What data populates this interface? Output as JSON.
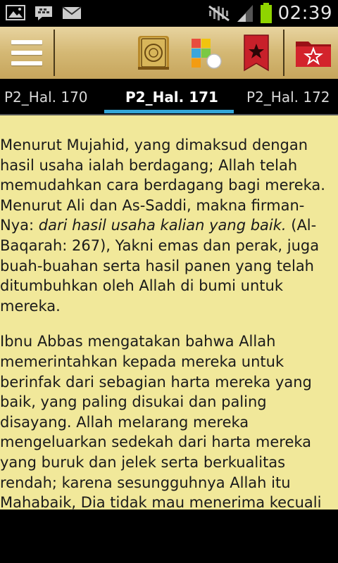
{
  "status_bar": {
    "time": "02:39",
    "icons": [
      "gallery-notification-icon",
      "bbm-notification-icon",
      "email-notification-icon",
      "mute-icon",
      "signal-icon",
      "battery-icon"
    ]
  },
  "action_bar": {
    "buttons": [
      "menu-icon",
      "quran-book-icon",
      "puzzle-icon",
      "bookmark-icon",
      "favorites-folder-icon"
    ],
    "colors": {
      "gradient_top": "#e8d4a0",
      "gradient_bottom": "#c6a55c"
    }
  },
  "tabs": [
    {
      "label": "P2_Hal. 170",
      "active": false
    },
    {
      "label": "P2_Hal. 171",
      "active": true
    },
    {
      "label": "P2_Hal. 172",
      "active": false
    }
  ],
  "content": {
    "p1_before_italic": "Menurut Mujahid, yang dimaksud dengan hasil usaha ialah berdagang; Allah telah memudahkan cara berdagang bagi mereka. Menurut Ali dan As-Saddi, makna firman-Nya: ",
    "p1_italic": "dari hasil usaha kalian yang baik.",
    "p1_after_italic": " (Al-Baqarah: 267), Yakni emas dan perak, juga buah-buahan serta hasil panen yang telah ditumbuhkan oleh Allah di bumi untuk mereka.",
    "p2": "Ibnu Abbas mengatakan bahwa Allah memerintahkan kepada mereka untuk berinfak dari sebagian harta mereka yang baik, yang paling disukai dan paling disayang. Allah melarang mereka mengeluarkan sedekah dari harta mereka yang buruk dan jelek serta berkualitas rendah; karena sesungguhnya Allah itu Mahabaik, Dia tidak mau menerima kecuali"
  },
  "colors": {
    "page_background": "#f1e89a",
    "tab_indicator": "#34a6d8"
  }
}
